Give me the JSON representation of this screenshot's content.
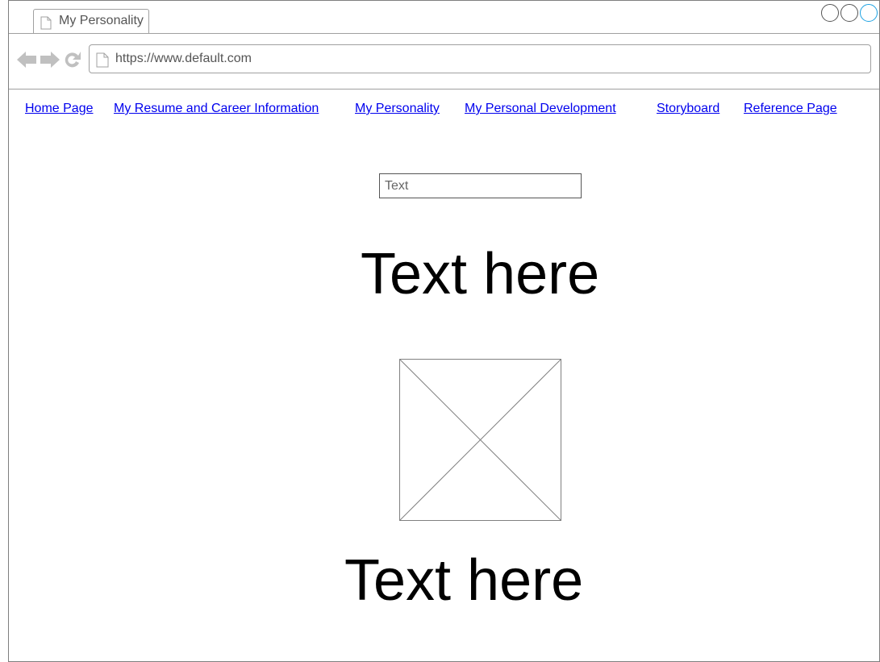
{
  "browser": {
    "tab_title": "My Personality",
    "url": "https://www.default.com",
    "icons": {
      "back": "arrow-left-icon",
      "forward": "arrow-right-icon",
      "reload": "reload-icon",
      "page": "page-icon"
    },
    "colors": {
      "active_control": "#1ba1e2",
      "link": "#0000ee"
    }
  },
  "nav": {
    "links": [
      {
        "label": "Home Page"
      },
      {
        "label": "My Resume and Career Information"
      },
      {
        "label": "My Personality"
      },
      {
        "label": "My Personal Development"
      },
      {
        "label": "Storyboard"
      },
      {
        "label": "Reference Page"
      }
    ]
  },
  "content": {
    "input_placeholder": "Text",
    "heading_top": "Text here",
    "image_icon": "image-placeholder-icon",
    "heading_bottom": "Text here"
  }
}
